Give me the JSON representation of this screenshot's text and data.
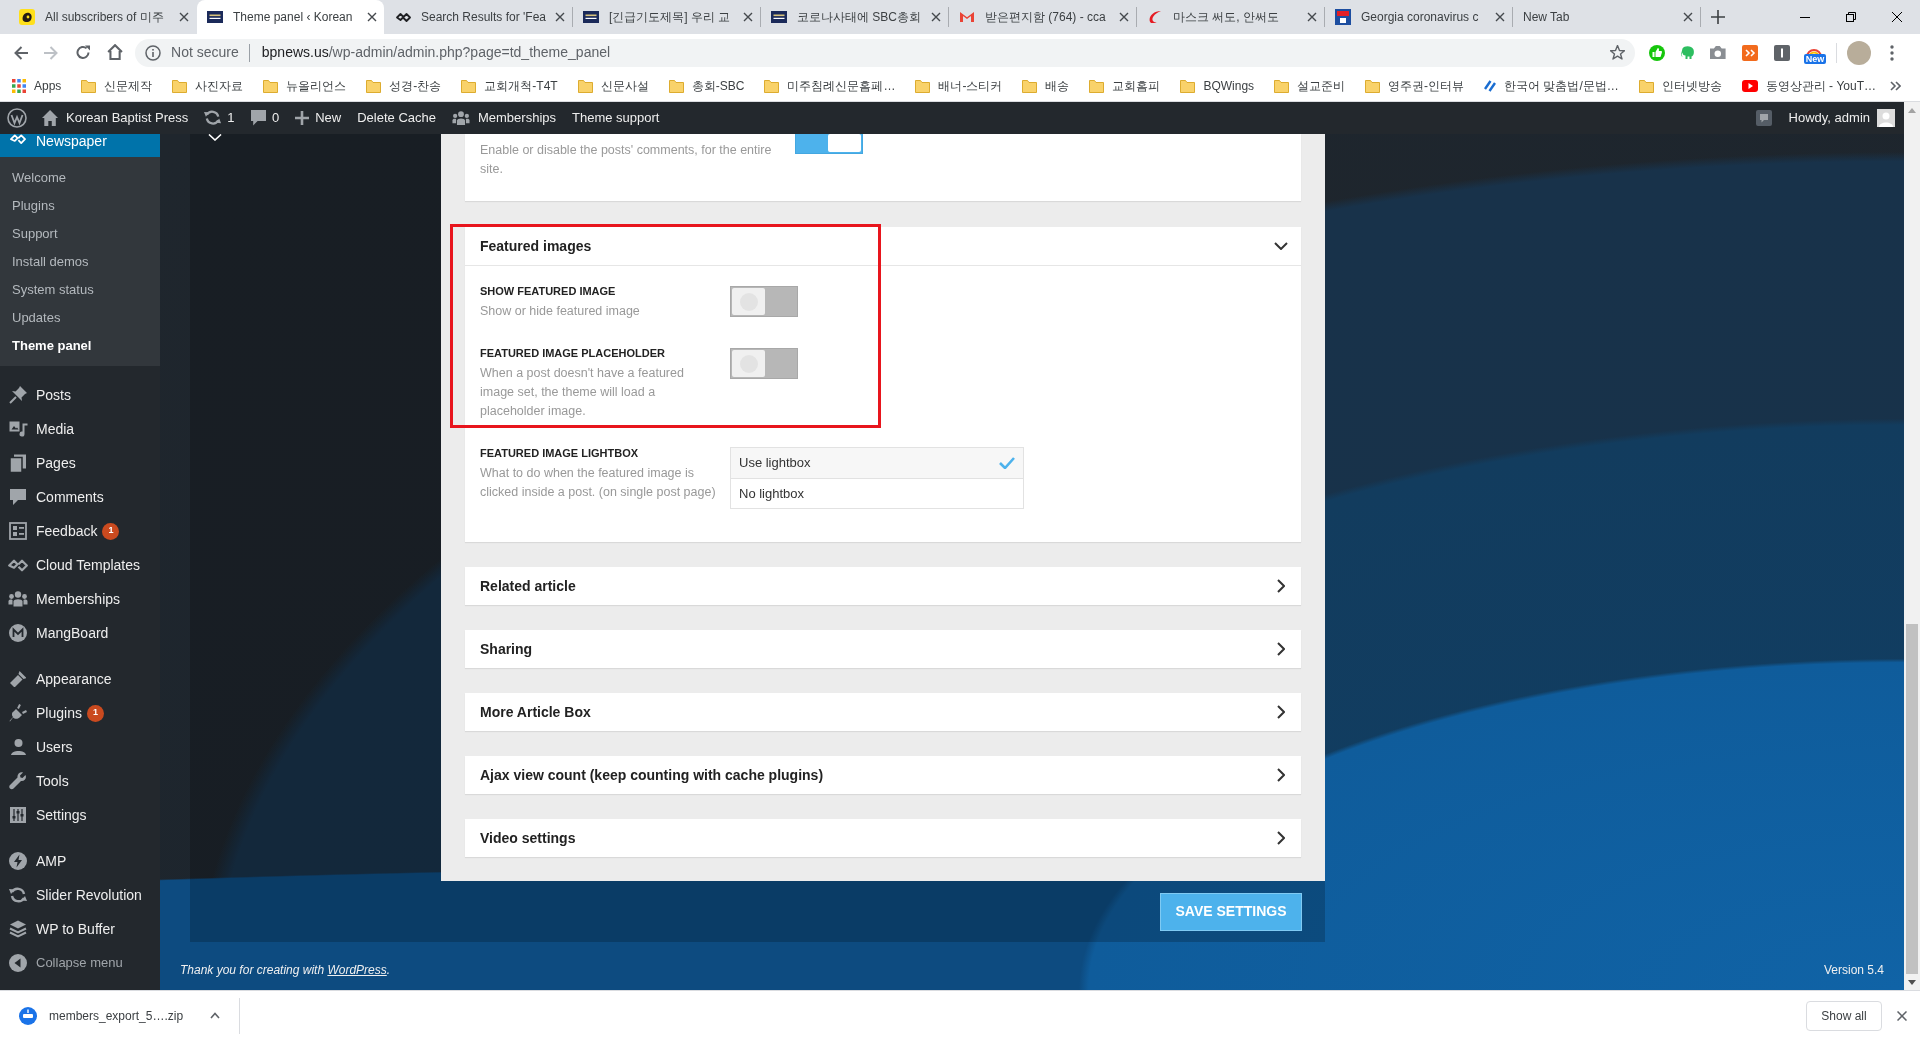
{
  "browser": {
    "tabs": [
      {
        "title": "All subscribers of 미주",
        "selected": false
      },
      {
        "title": "Theme panel ‹ Korean",
        "selected": true
      },
      {
        "title": "Search Results for 'Fea",
        "selected": false
      },
      {
        "title": "[긴급기도제목] 우리 교",
        "selected": false
      },
      {
        "title": "코로나사태에 SBC총회",
        "selected": false
      },
      {
        "title": "받은편지함 (764) - cca",
        "selected": false
      },
      {
        "title": "마스크 써도, 안써도",
        "selected": false
      },
      {
        "title": "Georgia coronavirus c",
        "selected": false
      },
      {
        "title": "New Tab",
        "selected": false
      }
    ],
    "address_bar": {
      "security_label": "Not secure",
      "host": "bpnews.us",
      "path": "/wp-admin/admin.php?page=td_theme_panel"
    },
    "extension_badge": "New",
    "bookmarks": [
      {
        "kind": "apps",
        "label": "Apps"
      },
      {
        "kind": "folder",
        "label": "신문제작"
      },
      {
        "kind": "folder",
        "label": "사진자료"
      },
      {
        "kind": "folder",
        "label": "뉴올리언스"
      },
      {
        "kind": "folder",
        "label": "성경-찬송"
      },
      {
        "kind": "folder",
        "label": "교회개척-T4T"
      },
      {
        "kind": "folder",
        "label": "신문사설"
      },
      {
        "kind": "folder",
        "label": "총회-SBC"
      },
      {
        "kind": "folder",
        "label": "미주침례신문홈페…"
      },
      {
        "kind": "folder",
        "label": "배너-스티커"
      },
      {
        "kind": "folder",
        "label": "배송"
      },
      {
        "kind": "folder",
        "label": "교회홈피"
      },
      {
        "kind": "folder",
        "label": "BQWings"
      },
      {
        "kind": "folder",
        "label": "설교준비"
      },
      {
        "kind": "folder",
        "label": "영주권-인터뷰"
      },
      {
        "kind": "link",
        "label": "한국어 맞춤법/문법…"
      },
      {
        "kind": "folder",
        "label": "인터넷방송"
      },
      {
        "kind": "link",
        "label": "동영상관리 - YouT…"
      }
    ]
  },
  "admin_bar": {
    "site_name": "Korean Baptist Press",
    "updates_count": "1",
    "comments_count": "0",
    "new_label": "New",
    "links": [
      "Delete Cache",
      "Memberships",
      "Theme support"
    ],
    "greeting": "Howdy, admin"
  },
  "sidebar": {
    "groups": [
      {
        "items": [
          {
            "label": "Newspaper",
            "selected": true,
            "children": [
              {
                "label": "Welcome",
                "selected": false
              },
              {
                "label": "Plugins",
                "selected": false
              },
              {
                "label": "Support",
                "selected": false
              },
              {
                "label": "Install demos",
                "selected": false
              },
              {
                "label": "System status",
                "selected": false
              },
              {
                "label": "Updates",
                "selected": false
              },
              {
                "label": "Theme panel",
                "selected": true
              }
            ]
          }
        ]
      },
      {
        "items": [
          {
            "label": "Posts",
            "selected": false
          },
          {
            "label": "Media",
            "selected": false
          },
          {
            "label": "Pages",
            "selected": false
          },
          {
            "label": "Comments",
            "selected": false
          },
          {
            "label": "Feedback",
            "selected": false,
            "badge": "1"
          },
          {
            "label": "Cloud Templates",
            "selected": false
          },
          {
            "label": "Memberships",
            "selected": false
          },
          {
            "label": "MangBoard",
            "selected": false
          }
        ]
      },
      {
        "items": [
          {
            "label": "Appearance",
            "selected": false
          },
          {
            "label": "Plugins",
            "selected": false,
            "badge": "1"
          },
          {
            "label": "Users",
            "selected": false
          },
          {
            "label": "Tools",
            "selected": false
          },
          {
            "label": "Settings",
            "selected": false
          }
        ]
      },
      {
        "items": [
          {
            "label": "AMP",
            "selected": false
          },
          {
            "label": "Slider Revolution",
            "selected": false
          },
          {
            "label": "WP to Buffer",
            "selected": false
          }
        ]
      }
    ],
    "collapse": "Collapse menu"
  },
  "theme_panel": {
    "top_setting": {
      "description": "Enable or disable the posts' comments, for the entire site.",
      "on": true
    },
    "sections": [
      {
        "title": "Featured images",
        "expanded": true,
        "highlight_frame": true,
        "options": [
          {
            "kind": "toggle",
            "label": "SHOW FEATURED IMAGE",
            "description": "Show or hide featured image",
            "on": false
          },
          {
            "kind": "toggle",
            "label": "FEATURED IMAGE PLACEHOLDER",
            "description": "When a post doesn't have a featured image set, the theme will load a placeholder image.",
            "on": false
          },
          {
            "kind": "choice",
            "label": "FEATURED IMAGE LIGHTBOX",
            "description": "What to do when the featured image is clicked inside a post. (on single post page)",
            "choices": [
              {
                "label": "Use lightbox",
                "selected": true
              },
              {
                "label": "No lightbox",
                "selected": false
              }
            ]
          }
        ]
      },
      {
        "title": "Related article",
        "expanded": false,
        "highlight_frame": false
      },
      {
        "title": "Sharing",
        "expanded": false,
        "highlight_frame": false
      },
      {
        "title": "More Article Box",
        "expanded": false,
        "highlight_frame": false
      },
      {
        "title": "Ajax view count (keep counting with cache plugins)",
        "expanded": false,
        "highlight_frame": false
      },
      {
        "title": "Video settings",
        "expanded": false,
        "highlight_frame": false
      }
    ],
    "save_button": "SAVE SETTINGS"
  },
  "footer": {
    "thanks_before": "Thank you for creating with ",
    "thanks_link": "WordPress",
    "thanks_after": ".",
    "version": "Version 5.4"
  },
  "download_bar": {
    "file_name": "members_export_5….zip",
    "show_all": "Show all"
  }
}
